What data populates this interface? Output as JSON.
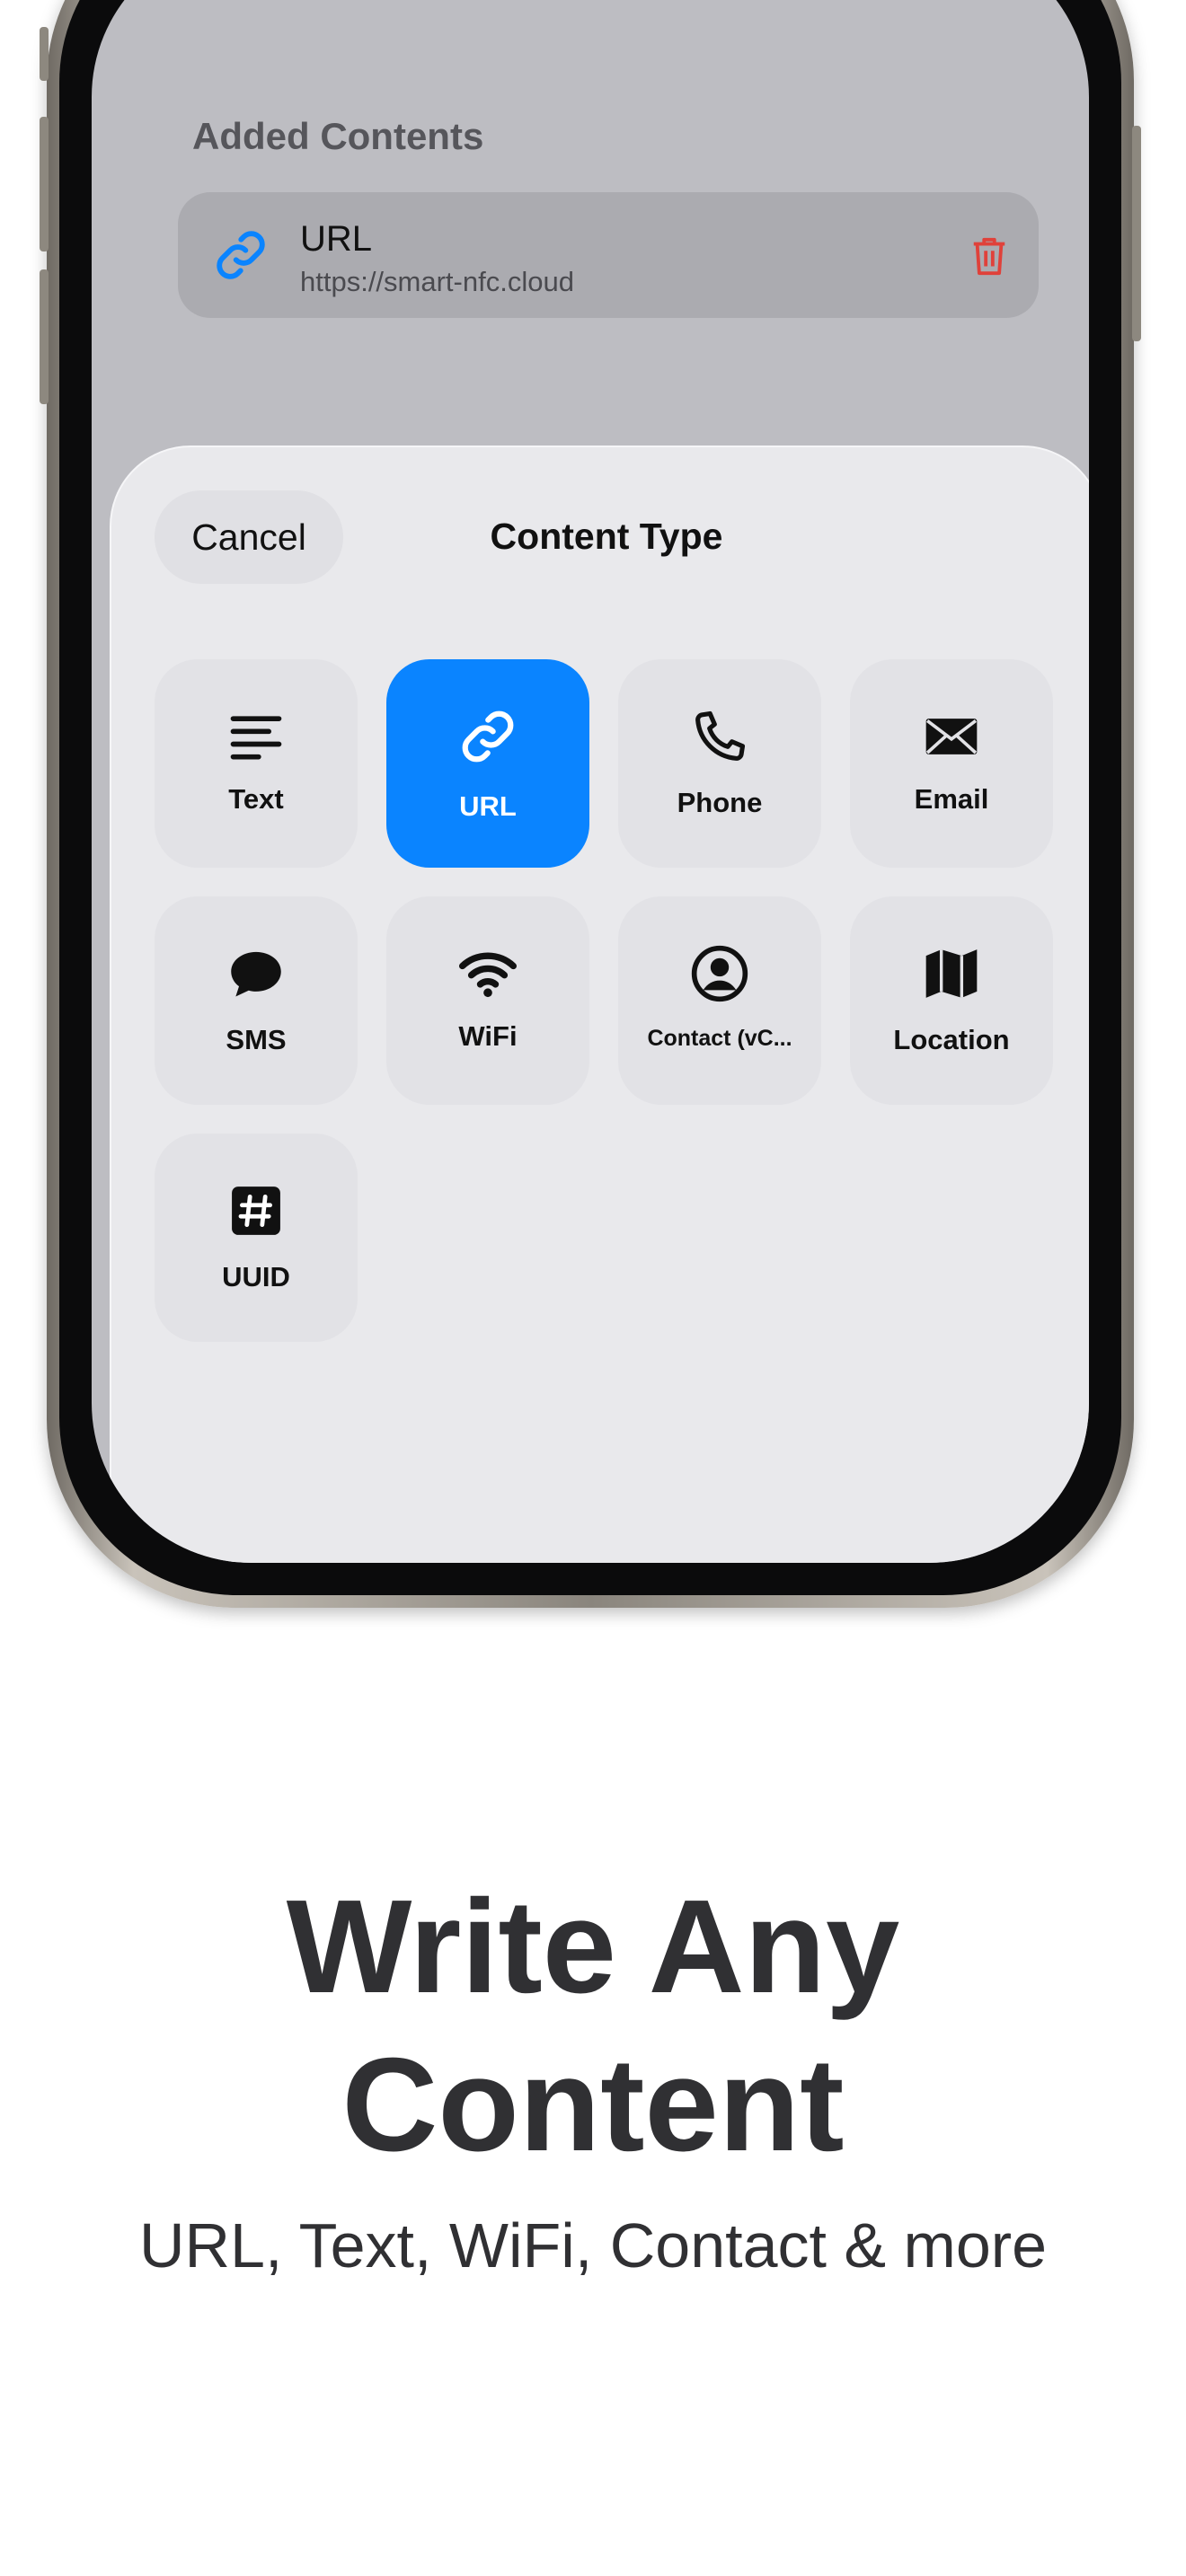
{
  "added_contents": {
    "heading": "Added Contents",
    "item": {
      "title": "URL",
      "subtitle": "https://smart-nfc.cloud",
      "icon": "link-icon",
      "delete_icon": "trash-icon"
    }
  },
  "sheet": {
    "cancel_label": "Cancel",
    "title": "Content Type",
    "selected": "URL",
    "types": [
      {
        "label": "Text",
        "icon": "text-lines-icon"
      },
      {
        "label": "URL",
        "icon": "link-icon"
      },
      {
        "label": "Phone",
        "icon": "phone-icon"
      },
      {
        "label": "Email",
        "icon": "envelope-icon"
      },
      {
        "label": "SMS",
        "icon": "message-bubble-icon"
      },
      {
        "label": "WiFi",
        "icon": "wifi-icon"
      },
      {
        "label": "Contact (vC...",
        "icon": "person-circle-icon"
      },
      {
        "label": "Location",
        "icon": "map-icon"
      },
      {
        "label": "UUID",
        "icon": "hash-icon"
      }
    ]
  },
  "promo": {
    "headline_line1": "Write Any",
    "headline_line2": "Content",
    "subline": "URL, Text, WiFi, Contact & more"
  },
  "colors": {
    "accent": "#0a84ff",
    "delete": "#e0413a",
    "text_dark": "#303033"
  }
}
